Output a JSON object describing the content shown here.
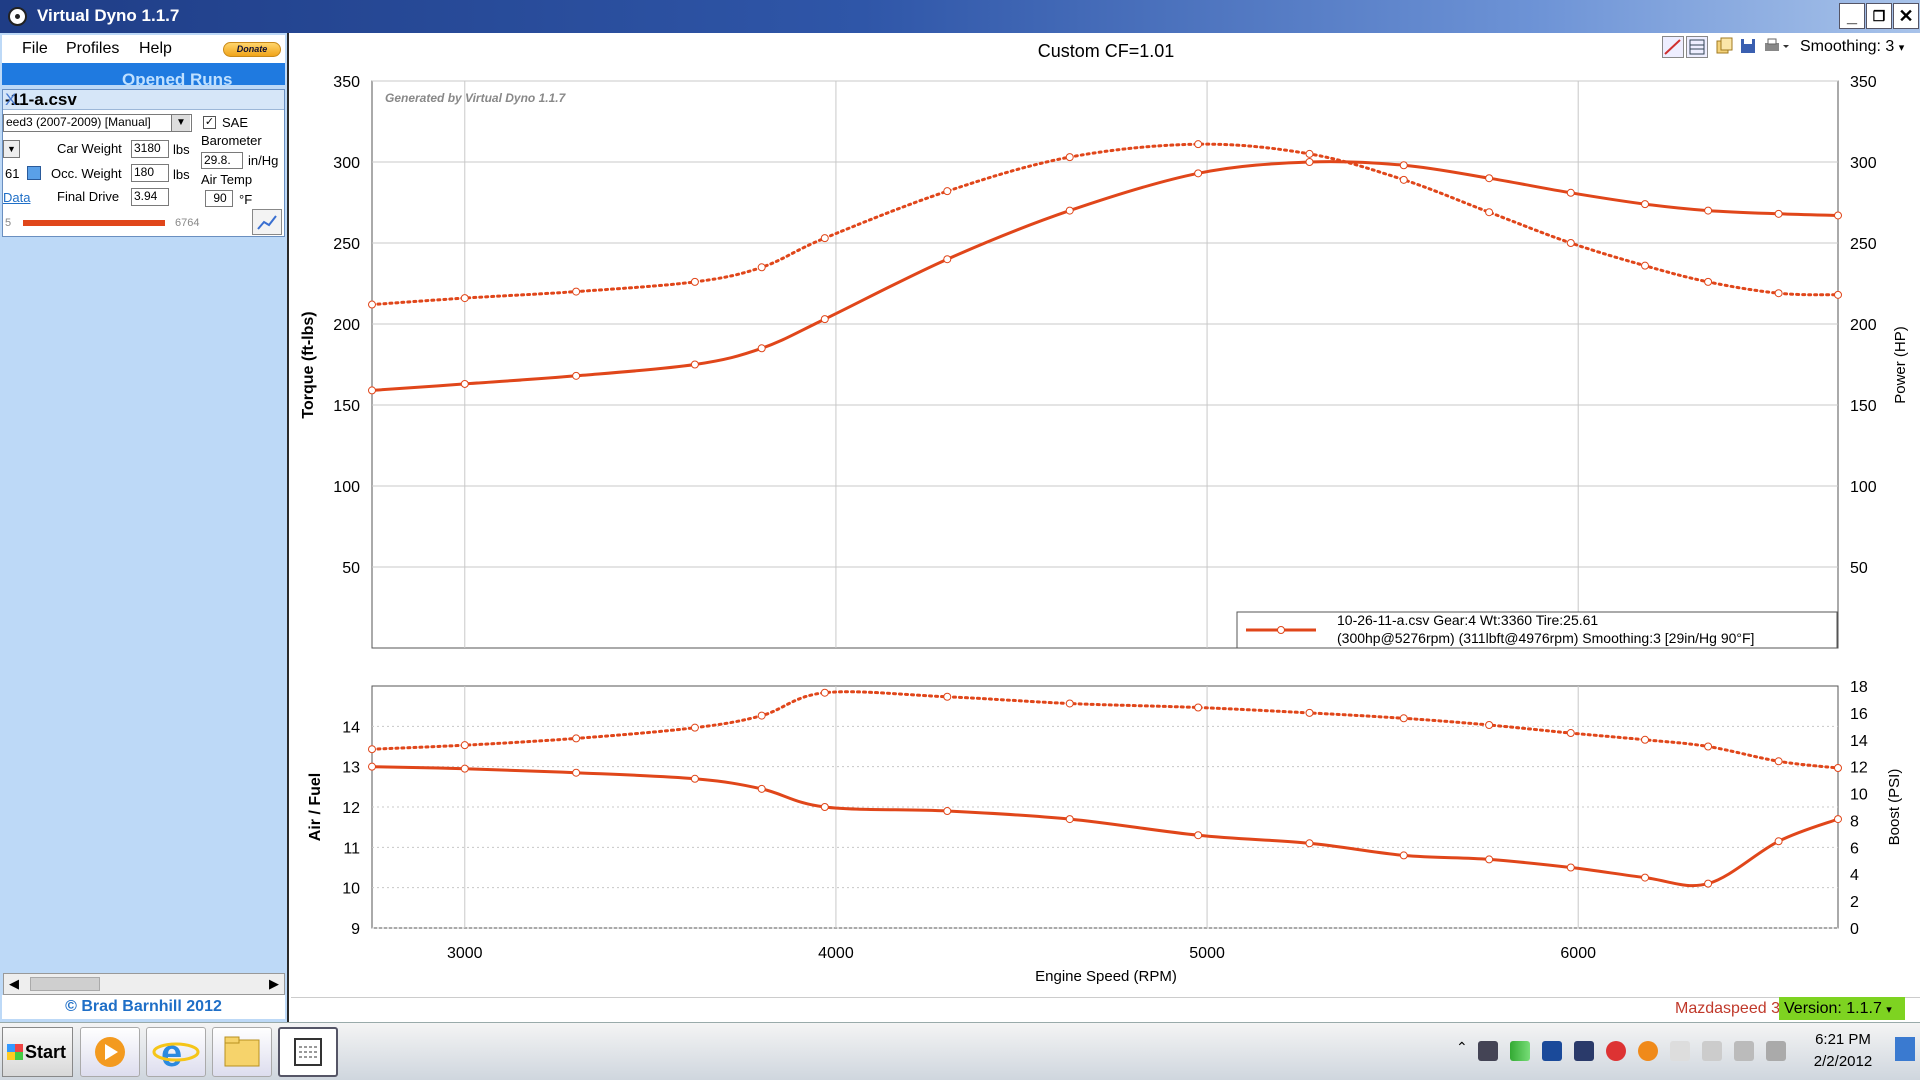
{
  "window": {
    "title": "Virtual Dyno 1.1.7"
  },
  "menu": {
    "file": "File",
    "profiles": "Profiles",
    "help": "Help",
    "donate": "Donate"
  },
  "left": {
    "opened_runs": "Opened Runs",
    "run_file": "-11-a.csv",
    "close": "X",
    "car_profile": "eed3 (2007-2009) [Manual]",
    "sae_label": "SAE",
    "car_weight_label": "Car Weight",
    "car_weight": "3180",
    "lbs": "lbs",
    "occ_weight_label": "Occ. Weight",
    "occ_weight": "180",
    "final_drive_label": "Final Drive",
    "final_drive": "3.94",
    "barometer_label": "Barometer",
    "barometer": "29.8.",
    "inhg": "in/Hg",
    "air_temp_label": "Air Temp",
    "air_temp": "90",
    "degf": "°F",
    "gear_value": "61",
    "data_link": "Data",
    "range_min": "5",
    "range_max": "6764",
    "copyright": "© Brad Barnhill 2012"
  },
  "toolbar": {
    "smoothing": "Smoothing: 3"
  },
  "status": {
    "car": "Mazdaspeed 3",
    "version": "Version: 1.1.7"
  },
  "taskbar": {
    "start": "Start",
    "time": "6:21 PM",
    "date": "2/2/2012"
  },
  "colors": {
    "series": "#e0461a",
    "accent": "#1f7ae0"
  },
  "chart_data": [
    {
      "type": "line",
      "title": "Custom CF=1.01",
      "watermark": "Generated by Virtual Dyno 1.1.7",
      "xlabel": "",
      "ylabel": "Torque (ft-lbs)",
      "y2label": "Power (HP)",
      "xlim": [
        2750,
        6700
      ],
      "ylim": [
        0,
        350
      ],
      "yticks": [
        50,
        100,
        150,
        200,
        250,
        300,
        350
      ],
      "grid": true,
      "legend": {
        "position": "bottom-right",
        "line1": "10-26-11-a.csv Gear:4 Wt:3360 Tire:25.61",
        "line2": "(300hp@5276rpm) (311lbft@4976rpm) Smoothing:3 [29in/Hg 90°F]"
      },
      "series": [
        {
          "style": "solid",
          "x": [
            2750,
            3000,
            3300,
            3620,
            3800,
            3970,
            4300,
            4630,
            4976,
            5276,
            5530,
            5760,
            5980,
            6180,
            6350,
            6540,
            6700
          ],
          "y": [
            159,
            163,
            168,
            175,
            185,
            203,
            240,
            270,
            293,
            300,
            298,
            290,
            281,
            274,
            270,
            268,
            267
          ]
        },
        {
          "style": "dotted",
          "x": [
            2750,
            3000,
            3300,
            3620,
            3800,
            3970,
            4300,
            4630,
            4976,
            5276,
            5530,
            5760,
            5980,
            6180,
            6350,
            6540,
            6700
          ],
          "y": [
            212,
            216,
            220,
            226,
            235,
            253,
            282,
            303,
            311,
            305,
            289,
            269,
            250,
            236,
            226,
            219,
            218
          ]
        }
      ]
    },
    {
      "type": "line",
      "xlabel": "Engine Speed (RPM)",
      "ylabel": "Air / Fuel",
      "y2label": "Boost (PSI)",
      "xlim": [
        2750,
        6700
      ],
      "xticks": [
        3000,
        4000,
        5000,
        6000
      ],
      "ylim": [
        9,
        15
      ],
      "yticks": [
        9,
        10,
        11,
        12,
        13,
        14
      ],
      "y2lim": [
        0,
        18
      ],
      "y2ticks": [
        0,
        2,
        4,
        6,
        8,
        10,
        12,
        14,
        16,
        18
      ],
      "grid": true,
      "series": [
        {
          "style": "solid",
          "x": [
            2750,
            3000,
            3300,
            3620,
            3800,
            3970,
            4300,
            4630,
            4976,
            5276,
            5530,
            5760,
            5980,
            6180,
            6350,
            6540,
            6700
          ],
          "y": [
            13.0,
            12.95,
            12.85,
            12.7,
            12.45,
            12.0,
            11.9,
            11.7,
            11.3,
            11.1,
            10.8,
            10.7,
            10.5,
            10.25,
            10.1,
            11.15,
            11.7
          ]
        },
        {
          "style": "dotted",
          "axis": "right",
          "x": [
            2750,
            3000,
            3300,
            3620,
            3800,
            3970,
            4300,
            4630,
            4976,
            5276,
            5530,
            5760,
            5980,
            6180,
            6350,
            6540,
            6700
          ],
          "y": [
            13.3,
            13.6,
            14.1,
            14.9,
            15.8,
            17.5,
            17.2,
            16.7,
            16.4,
            16.0,
            15.6,
            15.1,
            14.5,
            14.0,
            13.5,
            12.4,
            11.9
          ]
        }
      ]
    }
  ]
}
